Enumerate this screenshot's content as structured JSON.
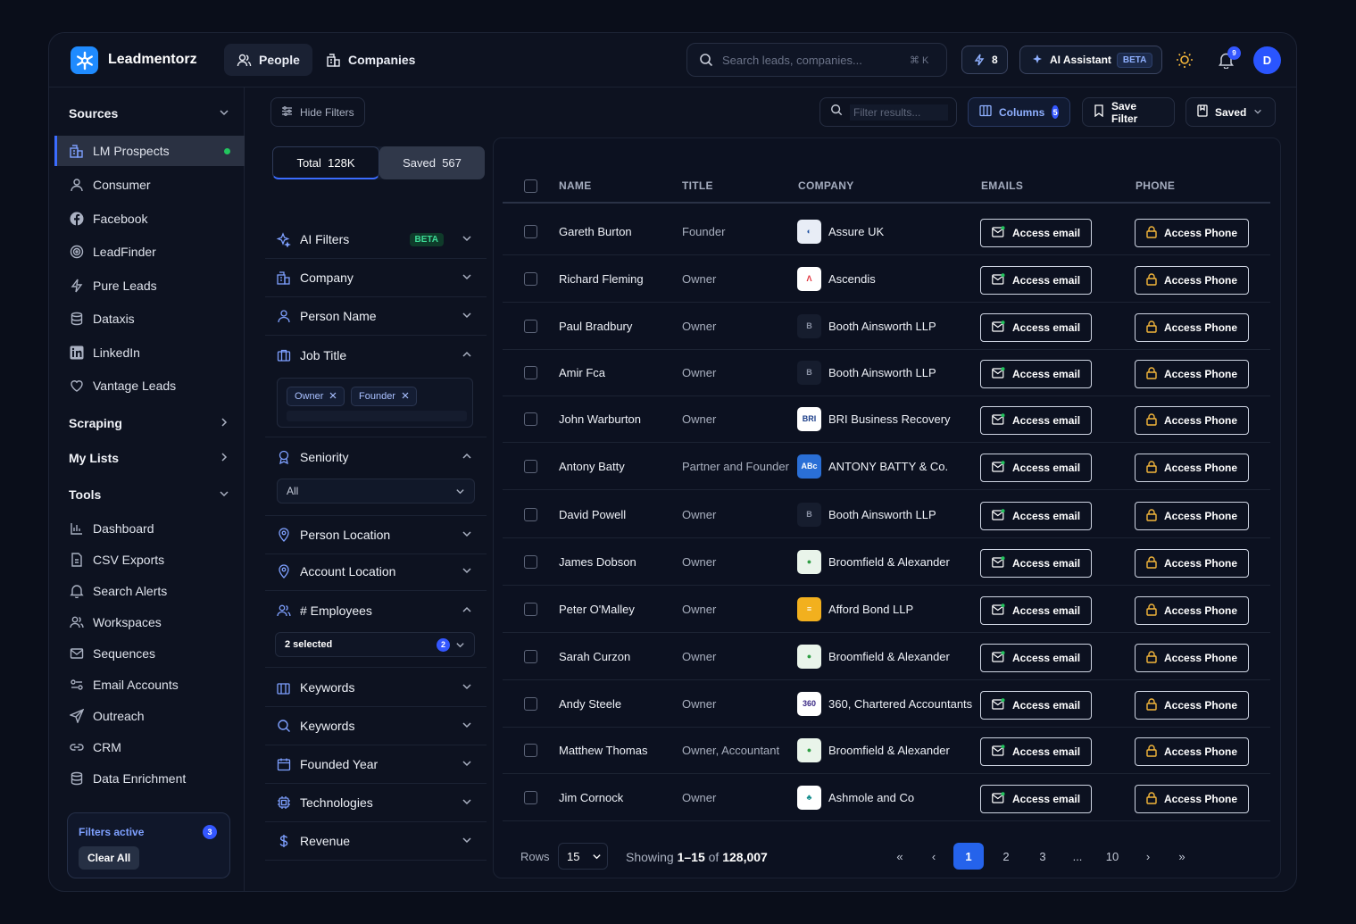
{
  "app": {
    "brand": "Leadmentorz"
  },
  "nav": {
    "people": "People",
    "companies": "Companies"
  },
  "search": {
    "placeholder": "Search leads, companies...",
    "shortcut": "⌘ K"
  },
  "credits": "8",
  "ai_assistant": {
    "label": "AI Assistant",
    "badge": "BETA"
  },
  "notifications": "9",
  "avatar": "D",
  "sidebar": {
    "sources_label": "Sources",
    "sources": [
      {
        "label": "LM Prospects",
        "icon": "building-icon",
        "active": true
      },
      {
        "label": "Consumer",
        "icon": "user-icon"
      },
      {
        "label": "Facebook",
        "icon": "facebook-icon"
      },
      {
        "label": "LeadFinder",
        "icon": "target-icon"
      },
      {
        "label": "Pure Leads",
        "icon": "bolt-icon"
      },
      {
        "label": "Dataxis",
        "icon": "database-icon"
      },
      {
        "label": "LinkedIn",
        "icon": "linkedin-icon"
      },
      {
        "label": "Vantage Leads",
        "icon": "heart-icon"
      }
    ],
    "scraping": "Scraping",
    "my_lists": "My Lists",
    "tools_label": "Tools",
    "tools": [
      {
        "label": "Dashboard",
        "icon": "chart-icon"
      },
      {
        "label": "CSV Exports",
        "icon": "file-icon"
      },
      {
        "label": "Search Alerts",
        "icon": "bell-icon"
      },
      {
        "label": "Workspaces",
        "icon": "users-icon"
      },
      {
        "label": "Sequences",
        "icon": "mail-icon"
      },
      {
        "label": "Email Accounts",
        "icon": "toggle-icon"
      },
      {
        "label": "Outreach",
        "icon": "send-icon"
      },
      {
        "label": "CRM",
        "icon": "link-icon"
      },
      {
        "label": "Data Enrichment",
        "icon": "database-icon"
      }
    ],
    "filters_active": "Filters active",
    "filters_count": "3",
    "clear_all": "Clear All"
  },
  "filters": {
    "hide": "Hide Filters",
    "total_label": "Total",
    "total_value": "128K",
    "saved_label": "Saved",
    "saved_value": "567",
    "ai_filters": "AI Filters",
    "ai_badge": "BETA",
    "company": "Company",
    "person_name": "Person Name",
    "job_title": "Job Title",
    "chips": [
      "Owner",
      "Founder"
    ],
    "seniority": "Seniority",
    "seniority_value": "All",
    "person_location": "Person Location",
    "account_location": "Account Location",
    "employees": "# Employees",
    "employees_value": "2 selected",
    "employees_count": "2",
    "keywords_1": "Keywords",
    "keywords_2": "Keywords",
    "founded_year": "Founded Year",
    "technologies": "Technologies",
    "revenue": "Revenue"
  },
  "toolbar": {
    "filter_placeholder": "Filter results...",
    "columns": "Columns",
    "columns_count": "5",
    "save_filter": "Save Filter",
    "saved": "Saved"
  },
  "table": {
    "headers": {
      "name": "NAME",
      "title": "TITLE",
      "company": "COMPANY",
      "emails": "EMAILS",
      "phone": "PHONE"
    },
    "email_btn": "Access email",
    "phone_btn": "Access Phone",
    "rows": [
      {
        "name": "Gareth Burton",
        "title": "Founder",
        "company": "Assure UK",
        "logo": "assure"
      },
      {
        "name": "Richard Fleming",
        "title": "Owner",
        "company": "Ascendis",
        "logo": "ascendis"
      },
      {
        "name": "Paul Bradbury",
        "title": "Owner",
        "company": "Booth Ainsworth LLP",
        "logo": "B"
      },
      {
        "name": "Amir Fca",
        "title": "Owner",
        "company": "Booth Ainsworth LLP",
        "logo": "B"
      },
      {
        "name": "John Warburton",
        "title": "Owner",
        "company": "BRI Business Recovery",
        "logo": "BRI"
      },
      {
        "name": "Antony Batty",
        "title": "Partner and Founder",
        "company": "ANTONY BATTY & Co.",
        "logo": "ABc"
      },
      {
        "name": "David Powell",
        "title": "Owner",
        "company": "Booth Ainsworth LLP",
        "logo": "B"
      },
      {
        "name": "James Dobson",
        "title": "Owner",
        "company": "Broomfield & Alexander",
        "logo": "broomfield"
      },
      {
        "name": "Peter O'Malley",
        "title": "Owner",
        "company": "Afford Bond LLP",
        "logo": "afford"
      },
      {
        "name": "Sarah Curzon",
        "title": "Owner",
        "company": "Broomfield & Alexander",
        "logo": "broomfield"
      },
      {
        "name": "Andy Steele",
        "title": "Owner",
        "company": "360, Chartered Accountants",
        "logo": "360"
      },
      {
        "name": "Matthew Thomas",
        "title": "Owner, Accountant",
        "company": "Broomfield & Alexander",
        "logo": "broomfield"
      },
      {
        "name": "Jim Cornock",
        "title": "Owner",
        "company": "Ashmole and Co",
        "logo": "ashmole"
      }
    ]
  },
  "pagination": {
    "rows_label": "Rows",
    "rows_value": "15",
    "showing_prefix": "Showing",
    "showing_range": "1–15",
    "showing_of": "of",
    "showing_total": "128,007",
    "pages": [
      "1",
      "2",
      "3",
      "...",
      "10"
    ],
    "first": "«",
    "prev": "‹",
    "next": "›",
    "last": "»"
  }
}
